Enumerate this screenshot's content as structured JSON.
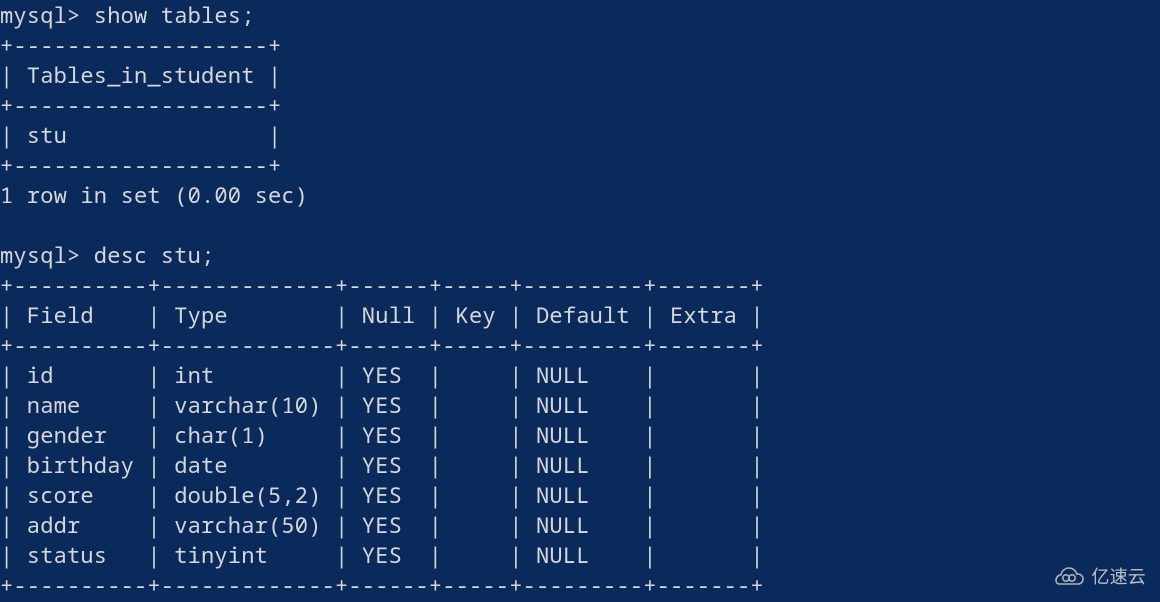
{
  "prompt": "mysql>",
  "cmd1": "show tables;",
  "cmd2": "desc stu;",
  "tables_heading": "Tables_in_student",
  "tables_row0": "stu",
  "rows_in_set": "1 row in set (0.00 sec)",
  "desc_cols": {
    "c0": "Field",
    "c1": "Type",
    "c2": "Null",
    "c3": "Key",
    "c4": "Default",
    "c5": "Extra"
  },
  "desc_rows": [
    {
      "field": "id",
      "type": "int",
      "null": "YES",
      "key": "",
      "default": "NULL",
      "extra": ""
    },
    {
      "field": "name",
      "type": "varchar(10)",
      "null": "YES",
      "key": "",
      "default": "NULL",
      "extra": ""
    },
    {
      "field": "gender",
      "type": "char(1)",
      "null": "YES",
      "key": "",
      "default": "NULL",
      "extra": ""
    },
    {
      "field": "birthday",
      "type": "date",
      "null": "YES",
      "key": "",
      "default": "NULL",
      "extra": ""
    },
    {
      "field": "score",
      "type": "double(5,2)",
      "null": "YES",
      "key": "",
      "default": "NULL",
      "extra": ""
    },
    {
      "field": "addr",
      "type": "varchar(50)",
      "null": "YES",
      "key": "",
      "default": "NULL",
      "extra": ""
    },
    {
      "field": "status",
      "type": "tinyint",
      "null": "YES",
      "key": "",
      "default": "NULL",
      "extra": ""
    }
  ],
  "watermark": "亿速云",
  "chart_data": {
    "type": "table",
    "title": "desc stu",
    "columns": [
      "Field",
      "Type",
      "Null",
      "Key",
      "Default",
      "Extra"
    ],
    "rows": [
      [
        "id",
        "int",
        "YES",
        "",
        "NULL",
        ""
      ],
      [
        "name",
        "varchar(10)",
        "YES",
        "",
        "NULL",
        ""
      ],
      [
        "gender",
        "char(1)",
        "YES",
        "",
        "NULL",
        ""
      ],
      [
        "birthday",
        "date",
        "YES",
        "",
        "NULL",
        ""
      ],
      [
        "score",
        "double(5,2)",
        "YES",
        "",
        "NULL",
        ""
      ],
      [
        "addr",
        "varchar(50)",
        "YES",
        "",
        "NULL",
        ""
      ],
      [
        "status",
        "tinyint",
        "YES",
        "",
        "NULL",
        ""
      ]
    ]
  }
}
